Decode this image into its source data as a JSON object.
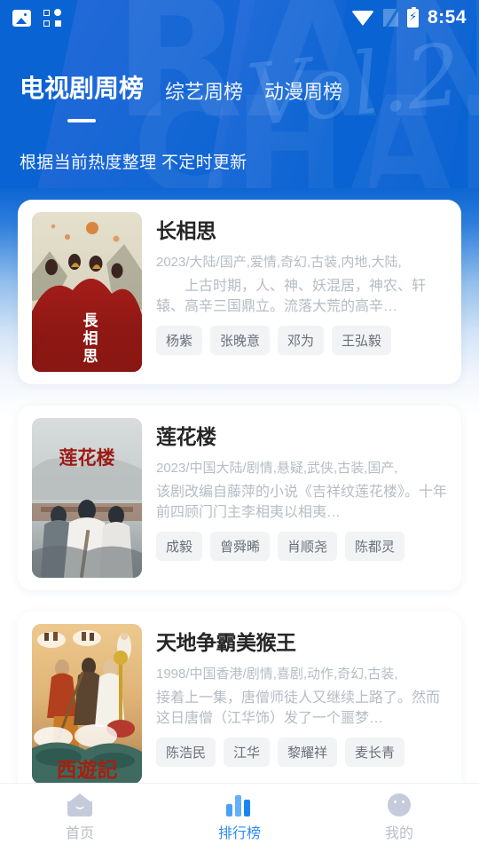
{
  "statusbar": {
    "time": "8:54",
    "icons": [
      "gallery-icon",
      "apps-grid-icon",
      "wifi-icon",
      "no-sim-icon",
      "battery-charging-icon"
    ]
  },
  "header": {
    "tabs": [
      {
        "label": "电视剧周榜",
        "active": true
      },
      {
        "label": "综艺周榜",
        "active": false
      },
      {
        "label": "动漫周榜",
        "active": false
      }
    ],
    "subtitle": "根据当前热度整理 不定时更新",
    "watermark_1": "RANK",
    "watermark_2": "CHART",
    "watermark_script": "Vol.2",
    "accent": "#0a63d2"
  },
  "list": [
    {
      "title": "长相思",
      "meta": "2023/大陆/国产,爱情,奇幻,古装,内地,大陆,",
      "desc": "上古时期，人、神、妖混居，神农、轩辕、高辛三国鼎立。流落大荒的高辛…",
      "tags": [
        "杨紫",
        "张晚意",
        "邓为",
        "王弘毅"
      ],
      "poster_alt": "长相思海报"
    },
    {
      "title": "莲花楼",
      "meta": "2023/中国大陆/剧情,悬疑,武侠,古装,国产,",
      "desc": "该剧改编自藤萍的小说《吉祥纹莲花楼》。十年前四顾门门主李相夷以相夷…",
      "tags": [
        "成毅",
        "曾舜晞",
        "肖顺尧",
        "陈都灵"
      ],
      "poster_alt": "莲花楼海报"
    },
    {
      "title": "天地争霸美猴王",
      "meta": "1998/中国香港/剧情,喜剧,动作,奇幻,古装,",
      "desc": "接着上一集，唐僧师徒人又继续上路了。然而这日唐僧（江华饰）发了一个噩梦…",
      "tags": [
        "陈浩民",
        "江华",
        "黎耀祥",
        "麦长青"
      ],
      "poster_alt": "天地争霸美猴王海报"
    }
  ],
  "tabbar": {
    "items": [
      {
        "label": "首页",
        "icon": "home-icon",
        "active": false
      },
      {
        "label": "排行榜",
        "icon": "chart-icon",
        "active": true
      },
      {
        "label": "我的",
        "icon": "face-icon",
        "active": false
      }
    ],
    "active_color": "#2f8cf5",
    "inactive_color": "#b9bec7"
  }
}
